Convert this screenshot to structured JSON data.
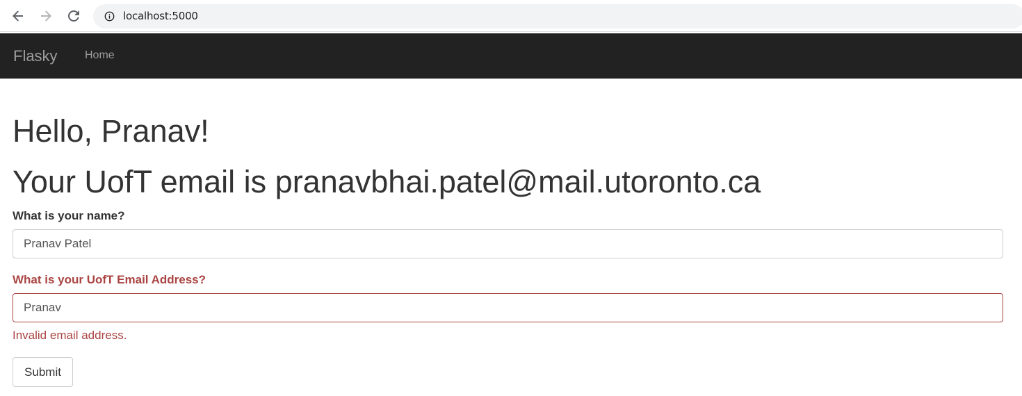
{
  "browser": {
    "url": "localhost:5000",
    "icons": [
      "arrow-left-icon",
      "arrow-right-icon",
      "reload-icon",
      "info-icon"
    ]
  },
  "navbar": {
    "brand": "Flasky",
    "links": [
      {
        "label": "Home"
      }
    ],
    "background": "#222222",
    "link_color": "#9d9d9d"
  },
  "main": {
    "greeting": "Hello, Pranav!",
    "email_heading": "Your UofT email is pranavbhai.patel@mail.utoronto.ca"
  },
  "form": {
    "name_label": "What is your name?",
    "name_value": "Pranav Patel",
    "email_label": "What is your UofT Email Address?",
    "email_value": "Pranav",
    "email_error": "Invalid email address.",
    "submit_label": "Submit",
    "error_color": "#a94442"
  }
}
